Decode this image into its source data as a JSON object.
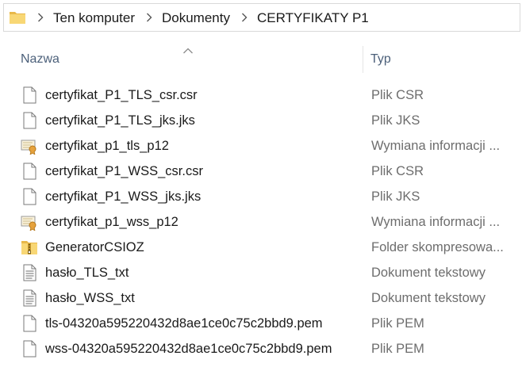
{
  "colors": {
    "header_text": "#4c607a",
    "file_text": "#1a1a1a",
    "type_text": "#6d6d6d",
    "folder_yellow": "#f8d775"
  },
  "address_bar": {
    "icon": "folder-icon",
    "breadcrumbs": [
      "Ten komputer",
      "Dokumenty",
      "CERTYFIKATY P1"
    ]
  },
  "columns": {
    "name": "Nazwa",
    "type": "Typ",
    "sort_indicator": "chevron-up-icon"
  },
  "files": [
    {
      "name": "certyfikat_P1_TLS_csr.csr",
      "type": "Plik CSR",
      "icon": "blank-file-icon"
    },
    {
      "name": "certyfikat_P1_TLS_jks.jks",
      "type": "Plik JKS",
      "icon": "blank-file-icon"
    },
    {
      "name": "certyfikat_p1_tls_p12",
      "type": "Wymiana informacji ...",
      "icon": "certificate-file-icon"
    },
    {
      "name": "certyfikat_P1_WSS_csr.csr",
      "type": "Plik CSR",
      "icon": "blank-file-icon"
    },
    {
      "name": "certyfikat_P1_WSS_jks.jks",
      "type": "Plik JKS",
      "icon": "blank-file-icon"
    },
    {
      "name": "certyfikat_p1_wss_p12",
      "type": "Wymiana informacji ...",
      "icon": "certificate-file-icon"
    },
    {
      "name": "GeneratorCSIOZ",
      "type": "Folder skompresowa...",
      "icon": "zip-folder-icon"
    },
    {
      "name": "hasło_TLS_txt",
      "type": "Dokument tekstowy",
      "icon": "text-file-icon"
    },
    {
      "name": "hasło_WSS_txt",
      "type": "Dokument tekstowy",
      "icon": "text-file-icon"
    },
    {
      "name": "tls-04320a595220432d8ae1ce0c75c2bbd9.pem",
      "type": "Plik PEM",
      "icon": "blank-file-icon"
    },
    {
      "name": "wss-04320a595220432d8ae1ce0c75c2bbd9.pem",
      "type": "Plik PEM",
      "icon": "blank-file-icon"
    }
  ]
}
